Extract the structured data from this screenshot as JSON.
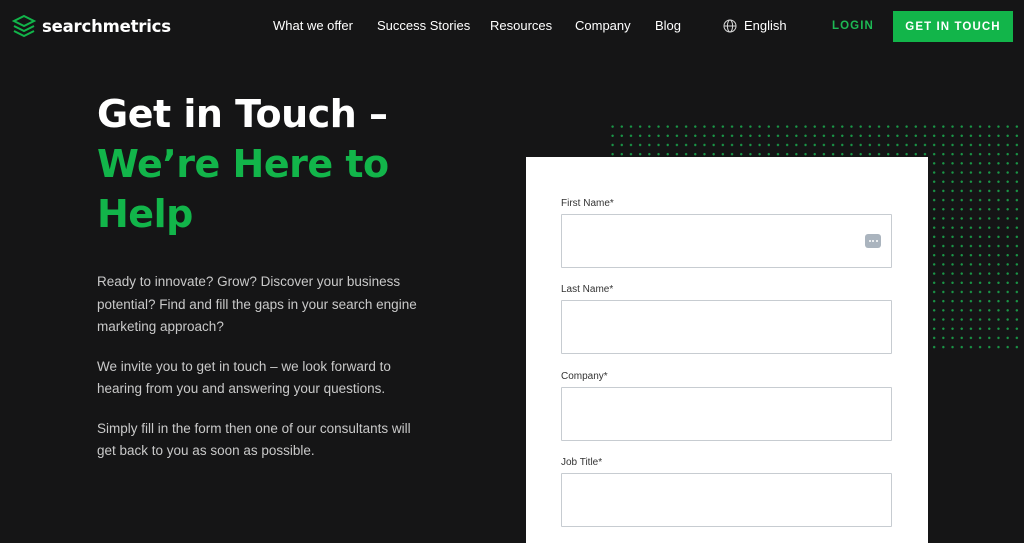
{
  "header": {
    "logo_text": "searchmetrics",
    "nav": [
      {
        "label": "What we offer"
      },
      {
        "label": "Success Stories"
      },
      {
        "label": "Resources"
      },
      {
        "label": "Company"
      },
      {
        "label": "Blog"
      }
    ],
    "language": "English",
    "login_label": "LOGIN",
    "cta_label": "GET IN TOUCH"
  },
  "hero": {
    "title_line1": "Get in Touch –",
    "title_line2": "We’re Here to Help",
    "paragraphs": [
      "Ready to innovate? Grow? Discover your business potential? Find and fill the gaps in your search engine marketing approach?",
      "We invite you to get in touch – we look forward to hearing from you and answering your questions.",
      "Simply fill in the form then one of our consultants will get back to you as soon as possible."
    ]
  },
  "form": {
    "fields": [
      {
        "label": "First Name*",
        "value": ""
      },
      {
        "label": "Last Name*",
        "value": ""
      },
      {
        "label": "Company*",
        "value": ""
      },
      {
        "label": "Job Title*",
        "value": ""
      }
    ]
  },
  "colors": {
    "background": "#151516",
    "accent": "#12b54a",
    "text": "#ffffff"
  },
  "icons": [
    "searchmetrics-logo-icon",
    "globe-icon",
    "autofill-icon"
  ]
}
